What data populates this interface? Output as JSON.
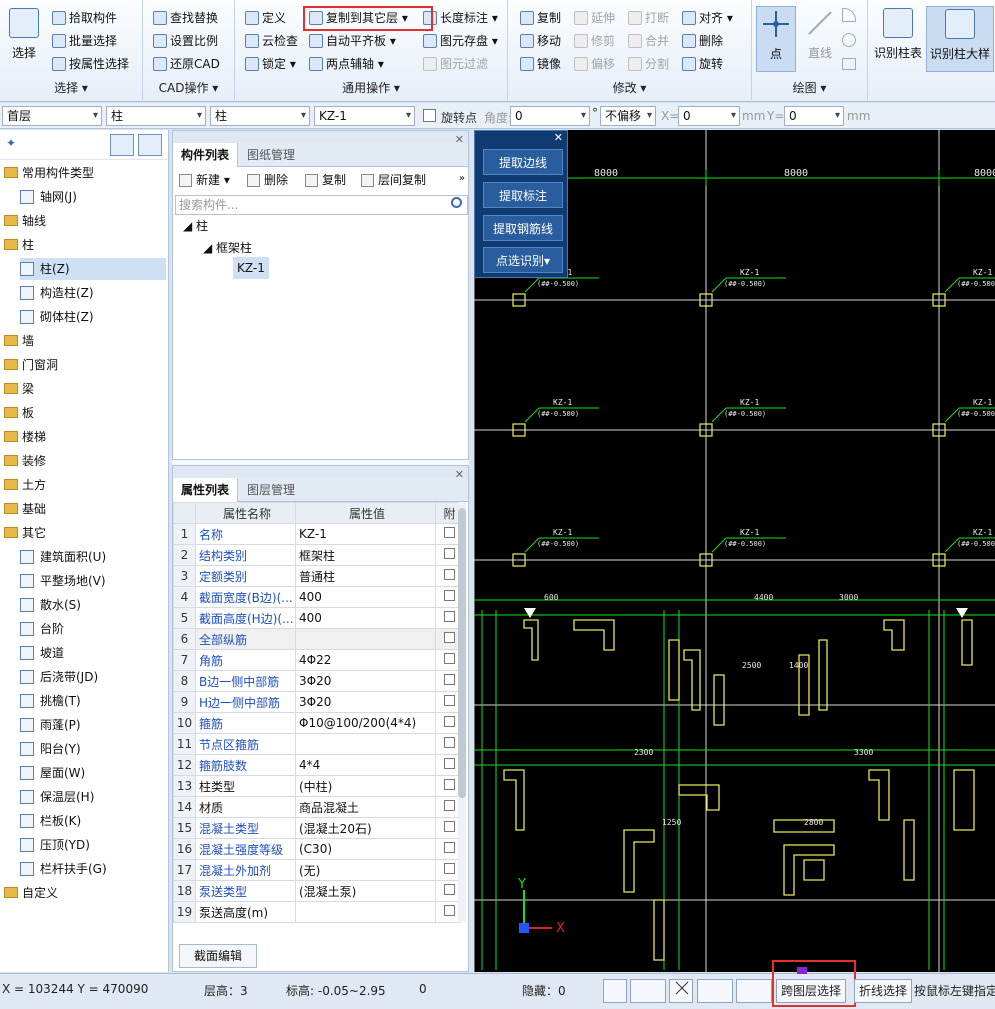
{
  "ribbon": {
    "select_group": {
      "big_button": "选择",
      "items": [
        "拾取构件",
        "批量选择",
        "按属性选择"
      ],
      "title": "选择 ▾"
    },
    "cad_group": {
      "items": [
        "查找替换",
        "设置比例",
        "还原CAD"
      ],
      "title": "CAD操作 ▾"
    },
    "general_group": {
      "col1": [
        "定义",
        "云检查",
        "锁定 ▾"
      ],
      "col2": [
        "复制到其它层 ▾",
        "自动平齐板 ▾",
        "两点辅轴 ▾"
      ],
      "col3": [
        "长度标注 ▾",
        "图元存盘 ▾",
        "图元过滤"
      ],
      "title": "通用操作 ▾"
    },
    "modify_group": {
      "col1": [
        "复制",
        "移动",
        "镜像"
      ],
      "col2": [
        "延伸",
        "修剪",
        "偏移"
      ],
      "col3": [
        "打断",
        "合并",
        "分割"
      ],
      "col4": [
        "对齐 ▾",
        "删除",
        "旋转"
      ],
      "title": "修改 ▾"
    },
    "draw_group": {
      "point": "点",
      "line": "直线",
      "title": "绘图 ▾"
    },
    "identify_group": {
      "btn1": "识别柱表",
      "btn2": "识别柱大样"
    }
  },
  "toolbar2": {
    "floor": "首层",
    "category": "柱",
    "subtype": "柱",
    "component": "KZ-1",
    "rotate_point": "旋转点",
    "angle_label": "角度:",
    "angle_value": "0",
    "degree": "°",
    "offset": "不偏移",
    "x_label": "X=",
    "x_value": "0",
    "mm1": "mm",
    "y_label": "Y=",
    "y_value": "0",
    "mm2": "mm"
  },
  "left_tree": [
    {
      "label": "常用构件类型",
      "type": "folder"
    },
    {
      "label": "轴网(J)",
      "type": "item"
    },
    {
      "label": "轴线",
      "type": "folder"
    },
    {
      "label": "柱",
      "type": "folder"
    },
    {
      "label": "柱(Z)",
      "type": "item",
      "selected": true
    },
    {
      "label": "构造柱(Z)",
      "type": "item"
    },
    {
      "label": "砌体柱(Z)",
      "type": "item"
    },
    {
      "label": "墙",
      "type": "folder"
    },
    {
      "label": "门窗洞",
      "type": "folder"
    },
    {
      "label": "梁",
      "type": "folder"
    },
    {
      "label": "板",
      "type": "folder"
    },
    {
      "label": "楼梯",
      "type": "folder"
    },
    {
      "label": "装修",
      "type": "folder"
    },
    {
      "label": "土方",
      "type": "folder"
    },
    {
      "label": "基础",
      "type": "folder"
    },
    {
      "label": "其它",
      "type": "folder"
    },
    {
      "label": "建筑面积(U)",
      "type": "item"
    },
    {
      "label": "平整场地(V)",
      "type": "item"
    },
    {
      "label": "散水(S)",
      "type": "item"
    },
    {
      "label": "台阶",
      "type": "item"
    },
    {
      "label": "坡道",
      "type": "item"
    },
    {
      "label": "后浇带(JD)",
      "type": "item"
    },
    {
      "label": "挑檐(T)",
      "type": "item"
    },
    {
      "label": "雨蓬(P)",
      "type": "item"
    },
    {
      "label": "阳台(Y)",
      "type": "item"
    },
    {
      "label": "屋面(W)",
      "type": "item"
    },
    {
      "label": "保温层(H)",
      "type": "item"
    },
    {
      "label": "栏板(K)",
      "type": "item"
    },
    {
      "label": "压顶(YD)",
      "type": "item"
    },
    {
      "label": "栏杆扶手(G)",
      "type": "item"
    },
    {
      "label": "自定义",
      "type": "folder"
    }
  ],
  "component_panel": {
    "tab_active": "构件列表",
    "tab_other": "图纸管理",
    "new": "新建 ▾",
    "delete": "删除",
    "copy": "复制",
    "floor_copy": "层间复制",
    "search_placeholder": "搜索构件...",
    "tree": [
      "柱",
      "框架柱",
      "KZ-1"
    ]
  },
  "property_panel": {
    "tab_active": "属性列表",
    "tab_other": "图层管理",
    "col_name": "属性名称",
    "col_value": "属性值",
    "col_extra": "附",
    "rows": [
      {
        "n": "1",
        "name": "名称",
        "value": "KZ-1"
      },
      {
        "n": "2",
        "name": "结构类别",
        "value": "框架柱"
      },
      {
        "n": "3",
        "name": "定额类别",
        "value": "普通柱"
      },
      {
        "n": "4",
        "name": "截面宽度(B边)(...",
        "value": "400"
      },
      {
        "n": "5",
        "name": "截面高度(H边)(...",
        "value": "400"
      },
      {
        "n": "6",
        "name": "全部纵筋",
        "value": ""
      },
      {
        "n": "7",
        "name": "角筋",
        "value": "4Φ22"
      },
      {
        "n": "8",
        "name": "B边一侧中部筋",
        "value": "3Φ20"
      },
      {
        "n": "9",
        "name": "H边一侧中部筋",
        "value": "3Φ20"
      },
      {
        "n": "10",
        "name": "箍筋",
        "value": "Φ10@100/200(4*4)"
      },
      {
        "n": "11",
        "name": "节点区箍筋",
        "value": ""
      },
      {
        "n": "12",
        "name": "箍筋肢数",
        "value": "4*4"
      },
      {
        "n": "13",
        "name": "柱类型",
        "value": "(中柱)"
      },
      {
        "n": "14",
        "name": "材质",
        "value": "商品混凝土"
      },
      {
        "n": "15",
        "name": "混凝土类型",
        "value": "(混凝土20石)"
      },
      {
        "n": "16",
        "name": "混凝土强度等级",
        "value": "(C30)"
      },
      {
        "n": "17",
        "name": "混凝土外加剂",
        "value": "(无)"
      },
      {
        "n": "18",
        "name": "泵送类型",
        "value": "(混凝土泵)"
      },
      {
        "n": "19",
        "name": "泵送高度(m)",
        "value": ""
      }
    ],
    "section_edit": "截面编辑"
  },
  "float_panel": [
    "提取边线",
    "提取标注",
    "提取钢筋线",
    "点选识别▾"
  ],
  "canvas": {
    "dims_top": [
      "8000",
      "8000",
      "8000"
    ],
    "column_label": "KZ-1",
    "column_sublabel": "(##-0.500)",
    "axis_x": "X",
    "axis_y": "Y"
  },
  "status": {
    "coords": "X = 103244 Y = 470090",
    "floor_height": "层高：3",
    "elevation": "标高: -0.05~2.95",
    "zero": "0",
    "hidden": "隐藏：0",
    "cross_layer": "跨图层选择",
    "polyline": "折线选择",
    "hint": "按鼠标左键指定"
  }
}
